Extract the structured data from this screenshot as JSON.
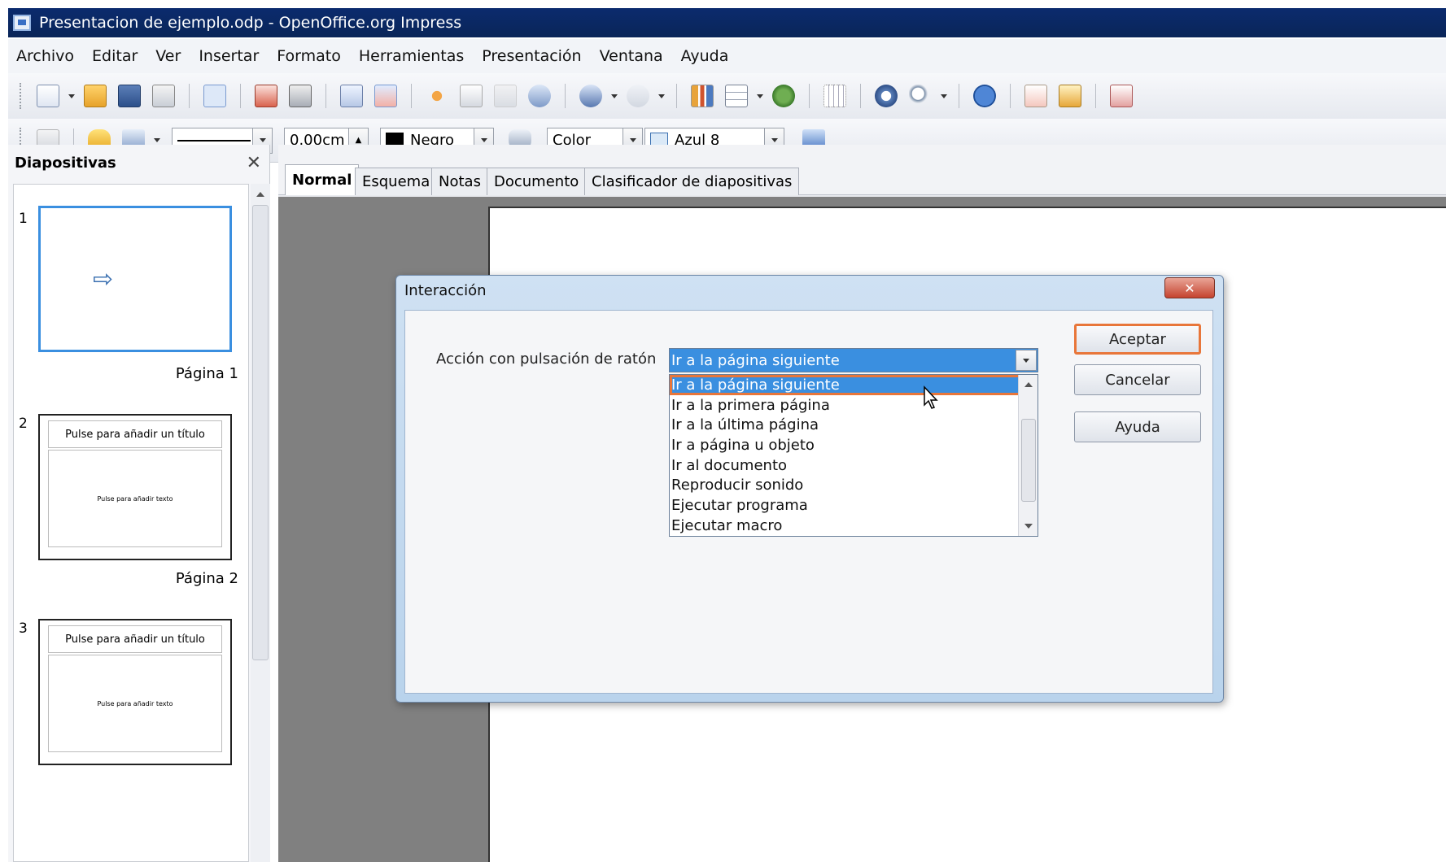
{
  "window": {
    "title": "Presentacion de ejemplo.odp - OpenOffice.org Impress"
  },
  "menu": [
    "Archivo",
    "Editar",
    "Ver",
    "Insertar",
    "Formato",
    "Herramientas",
    "Presentación",
    "Ventana",
    "Ayuda"
  ],
  "format_toolbar": {
    "line_width": "0.00cm",
    "line_color": "Negro",
    "fill_type": "Color",
    "fill_color": "Azul 8"
  },
  "slides_pane": {
    "title": "Diapositivas",
    "slides": [
      {
        "number": "1",
        "page_label": "Página 1"
      },
      {
        "number": "2",
        "page_label": "Página 2",
        "title_placeholder": "Pulse para añadir un título",
        "body_placeholder": "Pulse para añadir texto"
      },
      {
        "number": "3",
        "title_placeholder": "Pulse para añadir un título",
        "body_placeholder": "Pulse para añadir texto"
      }
    ]
  },
  "view_tabs": [
    "Normal",
    "Esquema",
    "Notas",
    "Documento",
    "Clasificador de diapositivas"
  ],
  "dialog": {
    "title": "Interacción",
    "action_label": "Acción con pulsación de ratón",
    "selected_action": "Ir a la página siguiente",
    "actions": [
      "Ir a la página siguiente",
      "Ir a la primera página",
      "Ir a la última página",
      "Ir a página u objeto",
      "Ir al documento",
      "Reproducir sonido",
      "Ejecutar programa",
      "Ejecutar macro"
    ],
    "buttons": {
      "ok": "Aceptar",
      "cancel": "Cancelar",
      "help": "Ayuda"
    }
  }
}
